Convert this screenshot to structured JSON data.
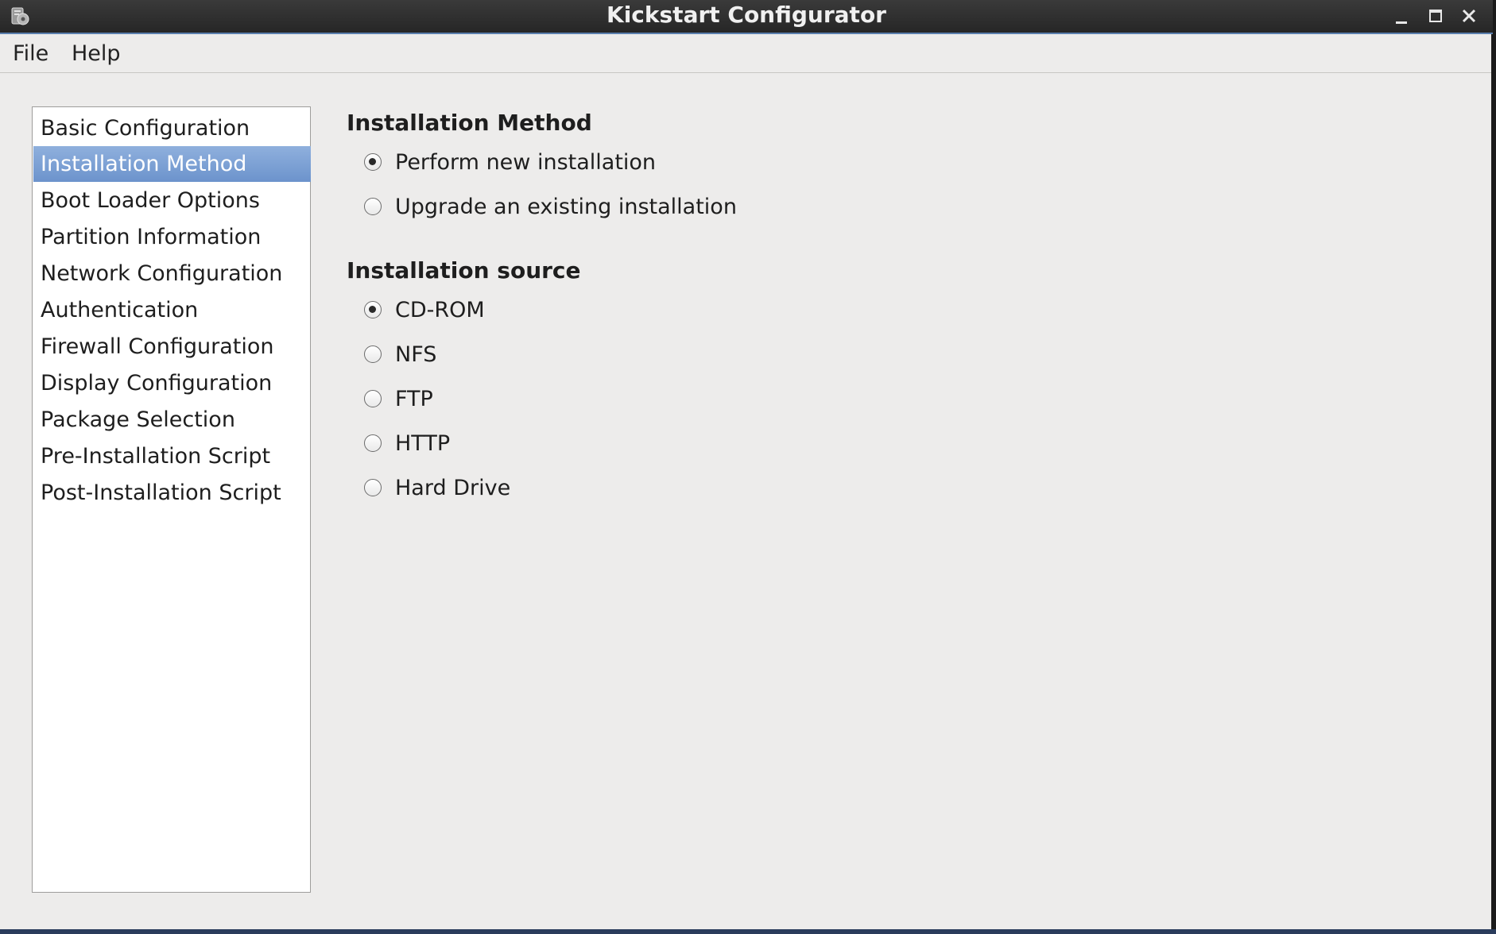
{
  "window": {
    "title": "Kickstart Configurator",
    "icons": {
      "app": "kickstart-app-icon",
      "minimize": "minimize-icon",
      "maximize": "maximize-icon",
      "close": "close-icon"
    }
  },
  "menubar": {
    "file": "File",
    "help": "Help"
  },
  "sidebar": {
    "selected_index": 1,
    "items": [
      {
        "label": "Basic Configuration"
      },
      {
        "label": "Installation Method"
      },
      {
        "label": "Boot Loader Options"
      },
      {
        "label": "Partition Information"
      },
      {
        "label": "Network Configuration"
      },
      {
        "label": "Authentication"
      },
      {
        "label": "Firewall Configuration"
      },
      {
        "label": "Display Configuration"
      },
      {
        "label": "Package Selection"
      },
      {
        "label": "Pre-Installation Script"
      },
      {
        "label": "Post-Installation Script"
      }
    ]
  },
  "main": {
    "method": {
      "title": "Installation Method",
      "options": [
        {
          "label": "Perform new installation",
          "selected": true
        },
        {
          "label": "Upgrade an existing installation",
          "selected": false
        }
      ]
    },
    "source": {
      "title": "Installation source",
      "options": [
        {
          "label": "CD-ROM",
          "selected": true
        },
        {
          "label": "NFS",
          "selected": false
        },
        {
          "label": "FTP",
          "selected": false
        },
        {
          "label": "HTTP",
          "selected": false
        },
        {
          "label": "Hard Drive",
          "selected": false
        }
      ]
    }
  },
  "colors": {
    "selection": "#7aa0d4",
    "window_bg": "#edeceb",
    "titlebar": "#2e2e2e"
  }
}
